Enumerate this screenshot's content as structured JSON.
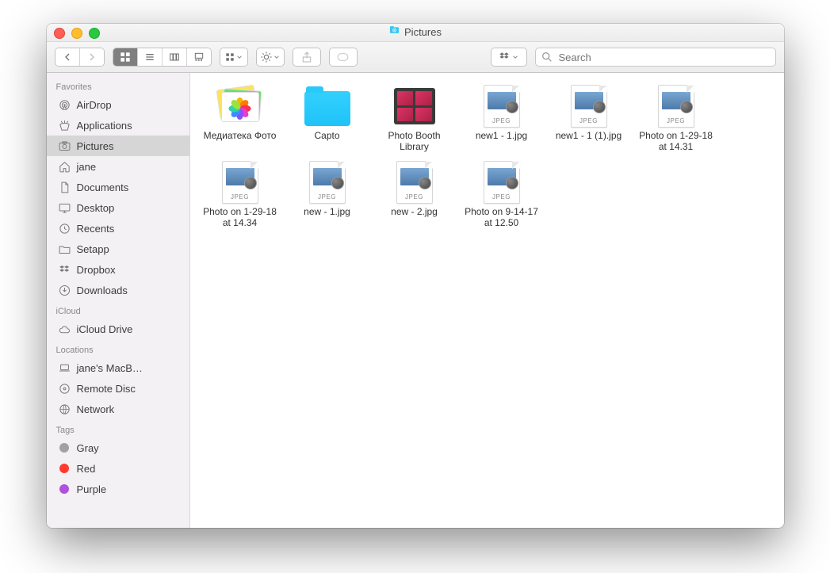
{
  "window": {
    "title": "Pictures"
  },
  "toolbar": {
    "search_placeholder": "Search"
  },
  "sidebar": {
    "sections": [
      {
        "header": "Favorites",
        "items": [
          {
            "icon": "airdrop",
            "label": "AirDrop"
          },
          {
            "icon": "apps",
            "label": "Applications"
          },
          {
            "icon": "pictures",
            "label": "Pictures",
            "selected": true
          },
          {
            "icon": "home",
            "label": "jane"
          },
          {
            "icon": "documents",
            "label": "Documents"
          },
          {
            "icon": "desktop",
            "label": "Desktop"
          },
          {
            "icon": "recents",
            "label": "Recents"
          },
          {
            "icon": "folder",
            "label": "Setapp"
          },
          {
            "icon": "dropbox",
            "label": "Dropbox"
          },
          {
            "icon": "downloads",
            "label": "Downloads"
          }
        ]
      },
      {
        "header": "iCloud",
        "items": [
          {
            "icon": "icloud",
            "label": "iCloud Drive"
          }
        ]
      },
      {
        "header": "Locations",
        "items": [
          {
            "icon": "laptop",
            "label": "jane's MacB…"
          },
          {
            "icon": "disc",
            "label": "Remote Disc"
          },
          {
            "icon": "globe",
            "label": "Network"
          }
        ]
      },
      {
        "header": "Tags",
        "items": [
          {
            "icon": "tag-gray",
            "label": "Gray"
          },
          {
            "icon": "tag-red",
            "label": "Red"
          },
          {
            "icon": "tag-purple",
            "label": "Purple"
          }
        ]
      }
    ]
  },
  "files": [
    {
      "kind": "photos-lib",
      "label": "Медиатека Фото"
    },
    {
      "kind": "folder",
      "label": "Capto"
    },
    {
      "kind": "photo-booth",
      "label": "Photo Booth Library"
    },
    {
      "kind": "jpeg",
      "label": "new1 - 1.jpg"
    },
    {
      "kind": "jpeg",
      "label": "new1 - 1 (1).jpg"
    },
    {
      "kind": "jpeg",
      "label": "Photo on 1-29-18 at 14.31"
    },
    {
      "kind": "jpeg",
      "label": "Photo on 1-29-18 at 14.34"
    },
    {
      "kind": "jpeg",
      "label": "new - 1.jpg"
    },
    {
      "kind": "jpeg",
      "label": "new - 2.jpg"
    },
    {
      "kind": "jpeg",
      "label": "Photo on 9-14-17 at 12.50"
    }
  ],
  "colors": {
    "sidebar_icon": "#7b7b7b",
    "folder_blue": "#1fc3f7"
  },
  "jpeg_badge": "JPEG"
}
